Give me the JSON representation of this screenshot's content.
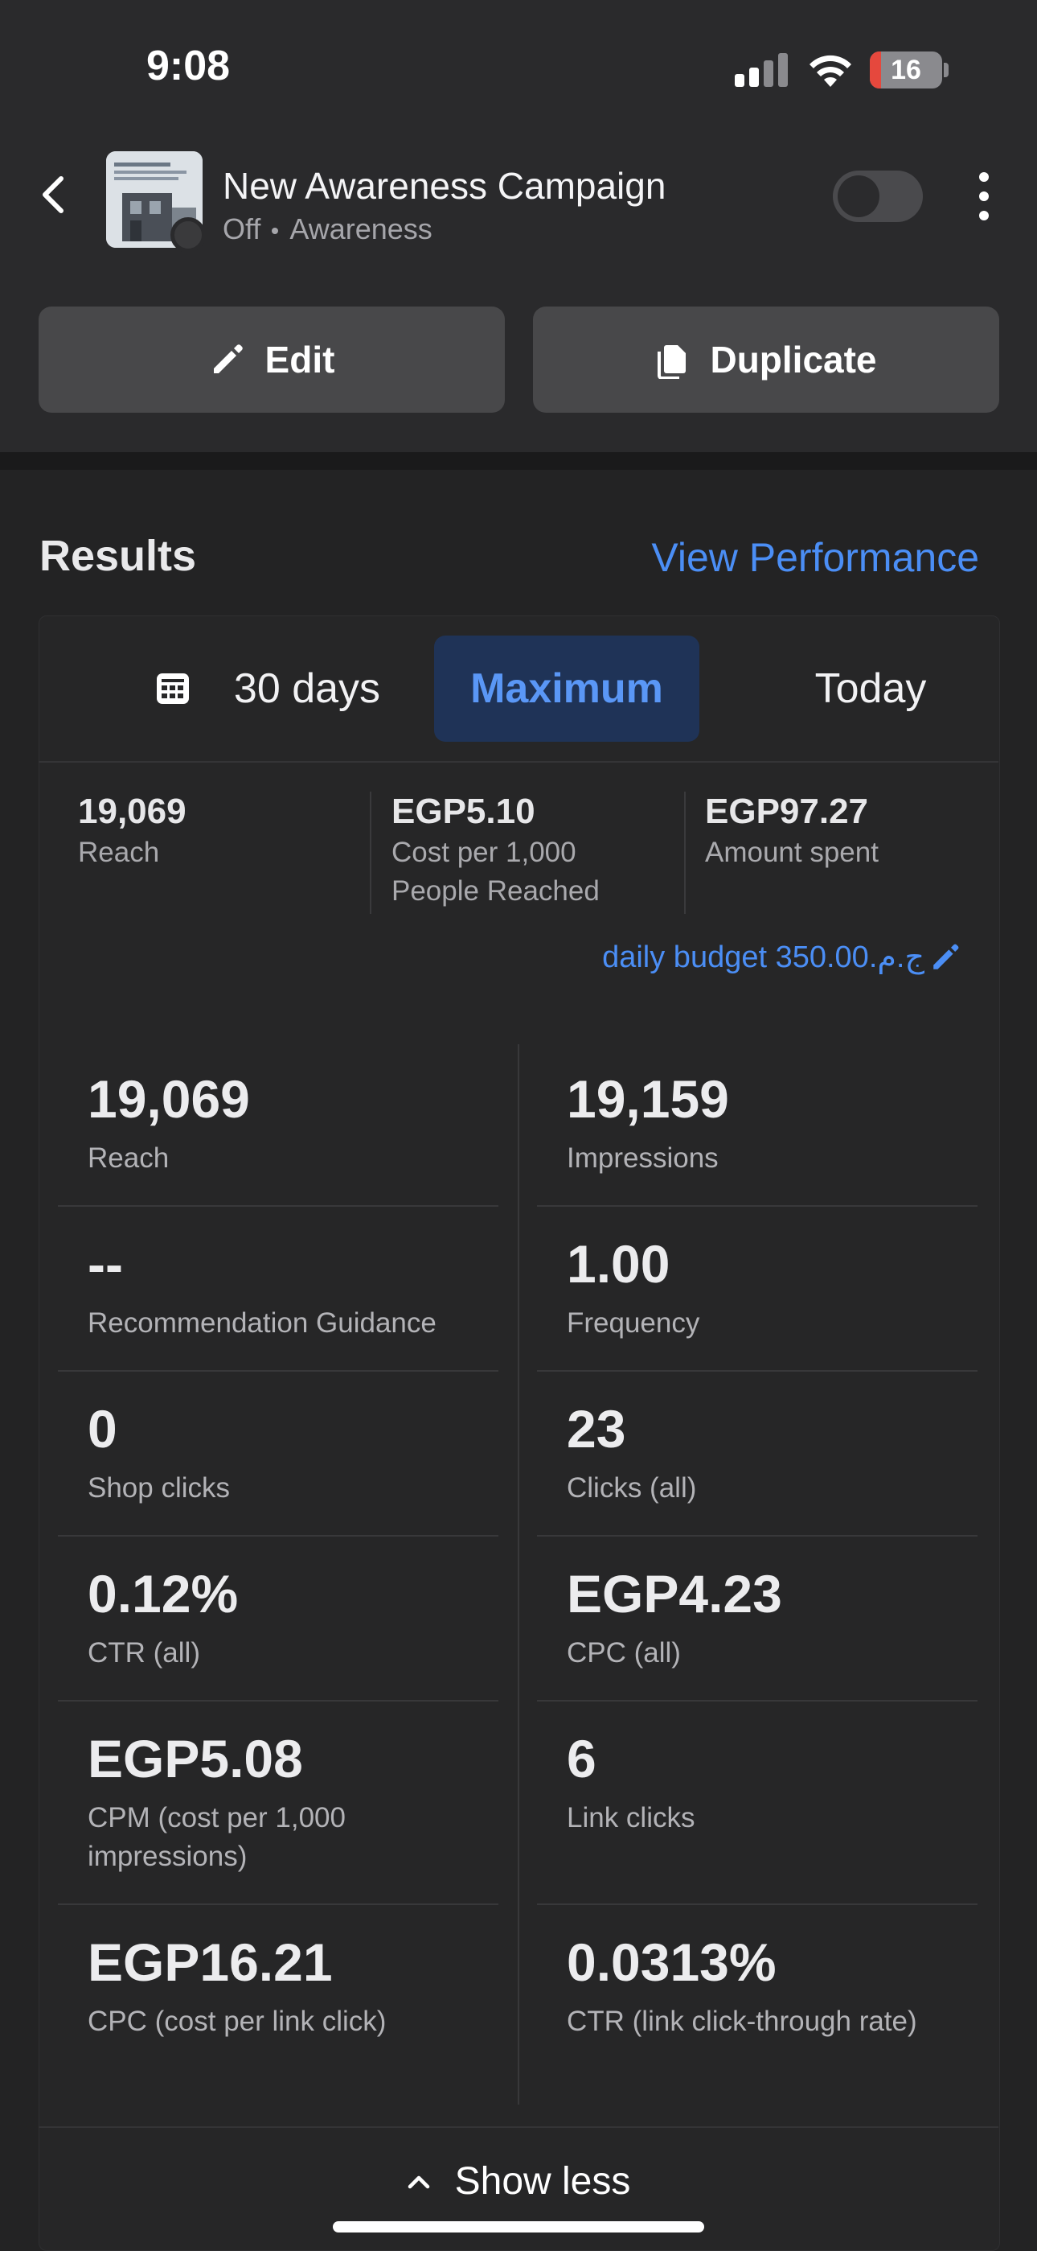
{
  "status_bar": {
    "time": "9:08",
    "battery": "16",
    "battery_level": 0.16
  },
  "header": {
    "back_icon": "chevron-left-icon",
    "campaign_title": "New Awareness Campaign",
    "status": "Off",
    "objective": "Awareness",
    "toggle_on": false,
    "more_icon": "more-vertical-icon"
  },
  "actions": {
    "edit_label": "Edit",
    "edit_icon": "pencil-icon",
    "duplicate_label": "Duplicate",
    "duplicate_icon": "copy-icon"
  },
  "results": {
    "title": "Results",
    "view_performance": "View Performance",
    "ranges": {
      "thirty_days": "30 days",
      "maximum": "Maximum",
      "today": "Today",
      "selected": "Maximum"
    },
    "summary": [
      {
        "value": "19,069",
        "label": "Reach"
      },
      {
        "value": "EGP5.10",
        "label": "Cost per 1,000\nPeople Reached"
      },
      {
        "value": "EGP97.27",
        "label": "Amount spent"
      }
    ],
    "daily_budget": "daily budget 350.00.ج.م",
    "metrics_left": [
      {
        "value": "19,069",
        "label": "Reach"
      },
      {
        "value": "--",
        "label": "Recommendation Guidance"
      },
      {
        "value": "0",
        "label": "Shop clicks"
      },
      {
        "value": "0.12%",
        "label": "CTR (all)"
      },
      {
        "value": "EGP5.08",
        "label": "CPM (cost per 1,000 impressions)"
      },
      {
        "value": "EGP16.21",
        "label": "CPC (cost per link click)"
      }
    ],
    "metrics_right": [
      {
        "value": "19,159",
        "label": "Impressions"
      },
      {
        "value": "1.00",
        "label": "Frequency"
      },
      {
        "value": "23",
        "label": "Clicks (all)"
      },
      {
        "value": "EGP4.23",
        "label": "CPC (all)"
      },
      {
        "value": "6",
        "label": "Link clicks"
      },
      {
        "value": "0.0313%",
        "label": "CTR (link click-through rate)"
      }
    ],
    "show_less": "Show less"
  },
  "colors": {
    "accent": "#4b8ef5",
    "selected_bg": "#1f3357",
    "battery_low": "#e5483d"
  }
}
